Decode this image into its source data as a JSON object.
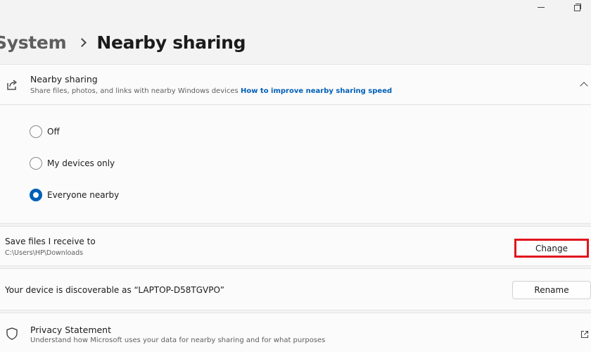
{
  "breadcrumb": {
    "parent": "System",
    "current": "Nearby sharing"
  },
  "nearby_sharing": {
    "title": "Nearby sharing",
    "description": "Share files, photos, and links with nearby Windows devices",
    "link_text": "How to improve nearby sharing speed",
    "icon": "share-icon",
    "options": [
      {
        "label": "Off",
        "selected": false
      },
      {
        "label": "My devices only",
        "selected": false
      },
      {
        "label": "Everyone nearby",
        "selected": true
      }
    ]
  },
  "save_files": {
    "title": "Save files I receive to",
    "path": "C:\\Users\\HP\\Downloads",
    "button_label": "Change"
  },
  "device": {
    "text": "Your device is discoverable as “LAPTOP-D58TGVPO”",
    "button_label": "Rename"
  },
  "privacy": {
    "title": "Privacy Statement",
    "description": "Understand how Microsoft uses your data for nearby sharing and for what purposes",
    "icon": "shield-icon"
  },
  "colors": {
    "accent": "#005fb8",
    "highlight_border": "#e1141c",
    "background": "#f3f3f3",
    "card": "#fbfbfb"
  }
}
